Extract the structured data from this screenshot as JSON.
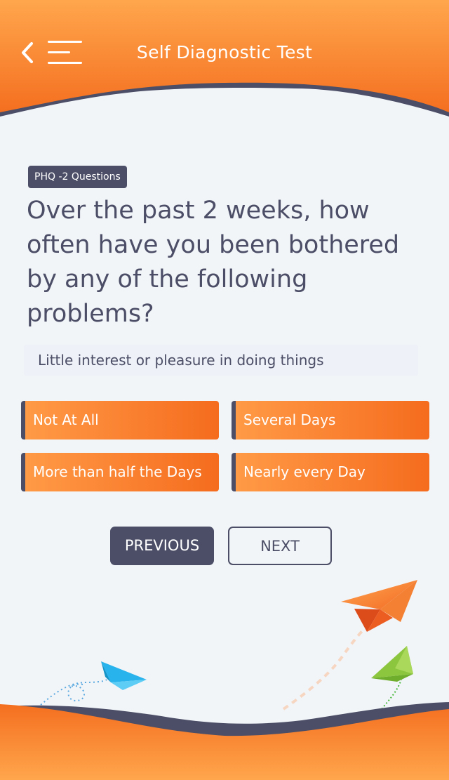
{
  "header": {
    "title": "Self Diagnostic Test",
    "back_icon": "chevron-left-icon",
    "menu_icon": "hamburger-menu-icon"
  },
  "questionnaire": {
    "section_badge": "PHQ -2 Questions",
    "question": "Over the past 2 weeks, how often have you been bothered by any of the following problems?",
    "item": "Little interest or pleasure in doing things",
    "options": [
      "Not At All",
      "Several Days",
      "More than half the Days",
      "Nearly every Day"
    ]
  },
  "navigation": {
    "previous_label": "PREVIOUS",
    "next_label": "NEXT"
  },
  "colors": {
    "accent_orange": "#f7782a",
    "accent_orange_light": "#ffa24a",
    "dark_slate": "#4b4e66",
    "background": "#f2f5f8"
  }
}
